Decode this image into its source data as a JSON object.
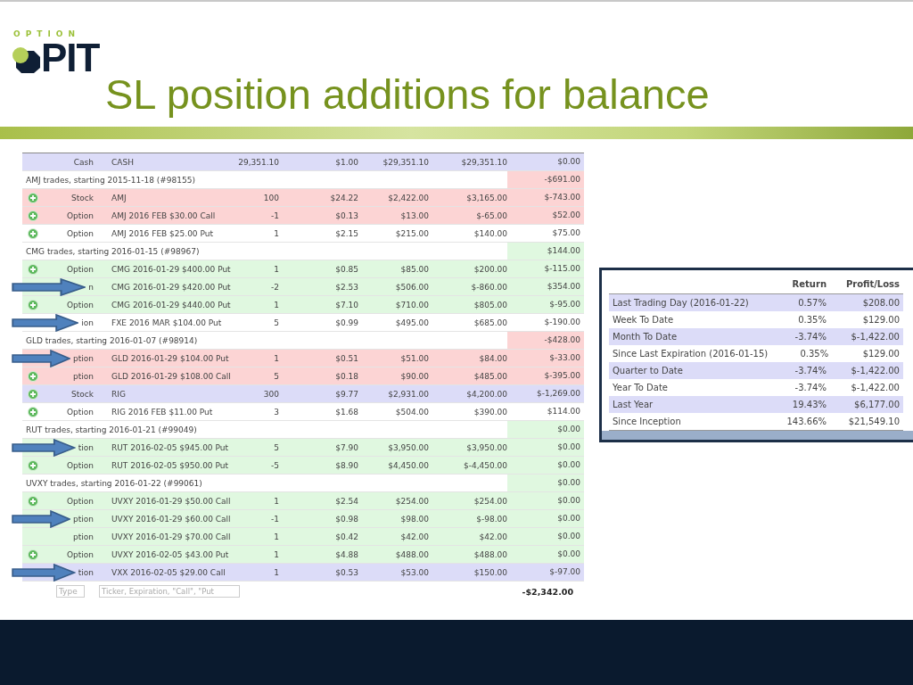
{
  "logo": {
    "top": "OPTION",
    "main": "PIT"
  },
  "title": "SL position additions for balance",
  "positions": {
    "rows": [
      {
        "kind": "position",
        "color": "#dcdcf8",
        "icon": false,
        "arrow": false,
        "type": "Cash",
        "description": "CASH",
        "quantity": "29,351.10",
        "price": "$1.00",
        "cost": "$29,351.10",
        "value": "$29,351.10",
        "pnl": "$0.00"
      },
      {
        "kind": "group",
        "label": "AMJ trades, starting 2015-11-18 (#98155)",
        "color": "#fcd4d4",
        "pnl": "-$691.00"
      },
      {
        "kind": "position",
        "color": "#fcd4d4",
        "icon": true,
        "arrow": false,
        "type": "Stock",
        "description": "AMJ",
        "quantity": "100",
        "price": "$24.22",
        "cost": "$2,422.00",
        "value": "$3,165.00",
        "pnl": "$-743.00"
      },
      {
        "kind": "position",
        "color": "#fcd4d4",
        "icon": true,
        "arrow": false,
        "type": "Option",
        "description": "AMJ 2016 FEB $30.00 Call",
        "quantity": "-1",
        "price": "$0.13",
        "cost": "$13.00",
        "value": "$-65.00",
        "pnl": "$52.00"
      },
      {
        "kind": "position",
        "color": "#ffffff",
        "icon": true,
        "arrow": false,
        "type": "Option",
        "description": "AMJ 2016 FEB $25.00 Put",
        "quantity": "1",
        "price": "$2.15",
        "cost": "$215.00",
        "value": "$140.00",
        "pnl": "$75.00"
      },
      {
        "kind": "group",
        "label": "CMG trades, starting 2016-01-15 (#98967)",
        "color": "#e0f8e0",
        "pnl": "$144.00"
      },
      {
        "kind": "position",
        "color": "#e0f8e0",
        "icon": true,
        "arrow": false,
        "type": "Option",
        "description": "CMG 2016-01-29 $400.00 Put",
        "quantity": "1",
        "price": "$0.85",
        "cost": "$85.00",
        "value": "$200.00",
        "pnl": "$-115.00"
      },
      {
        "kind": "position",
        "color": "#e0f8e0",
        "icon": false,
        "arrow": true,
        "type": "n",
        "description": "CMG 2016-01-29 $420.00 Put",
        "quantity": "-2",
        "price": "$2.53",
        "cost": "$506.00",
        "value": "$-860.00",
        "pnl": "$354.00"
      },
      {
        "kind": "position",
        "color": "#e0f8e0",
        "icon": true,
        "arrow": false,
        "type": "Option",
        "description": "CMG 2016-01-29 $440.00 Put",
        "quantity": "1",
        "price": "$7.10",
        "cost": "$710.00",
        "value": "$805.00",
        "pnl": "$-95.00"
      },
      {
        "kind": "position",
        "color": "#ffffff",
        "icon": false,
        "arrow": true,
        "type": "ion",
        "description": "FXE 2016 MAR $104.00 Put",
        "quantity": "5",
        "price": "$0.99",
        "cost": "$495.00",
        "value": "$685.00",
        "pnl": "$-190.00"
      },
      {
        "kind": "group",
        "label": "GLD trades, starting 2016-01-07 (#98914)",
        "color": "#fcd4d4",
        "pnl": "-$428.00"
      },
      {
        "kind": "position",
        "color": "#fcd4d4",
        "icon": false,
        "arrow": true,
        "type": "ption",
        "description": "GLD 2016-01-29 $104.00 Put",
        "quantity": "1",
        "price": "$0.51",
        "cost": "$51.00",
        "value": "$84.00",
        "pnl": "$-33.00"
      },
      {
        "kind": "position",
        "color": "#fcd4d4",
        "icon": true,
        "arrow": false,
        "type": "ption",
        "description": "GLD 2016-01-29 $108.00 Call",
        "quantity": "5",
        "price": "$0.18",
        "cost": "$90.00",
        "value": "$485.00",
        "pnl": "$-395.00"
      },
      {
        "kind": "position",
        "color": "#dcdcf8",
        "icon": true,
        "arrow": false,
        "type": "Stock",
        "description": "RIG",
        "quantity": "300",
        "price": "$9.77",
        "cost": "$2,931.00",
        "value": "$4,200.00",
        "pnl": "$-1,269.00"
      },
      {
        "kind": "position",
        "color": "#ffffff",
        "icon": true,
        "arrow": false,
        "type": "Option",
        "description": "RIG 2016 FEB $11.00 Put",
        "quantity": "3",
        "price": "$1.68",
        "cost": "$504.00",
        "value": "$390.00",
        "pnl": "$114.00"
      },
      {
        "kind": "group",
        "label": "RUT trades, starting 2016-01-21 (#99049)",
        "color": "#e0f8e0",
        "pnl": "$0.00"
      },
      {
        "kind": "position",
        "color": "#e0f8e0",
        "icon": false,
        "arrow": true,
        "type": "tion",
        "description": "RUT 2016-02-05 $945.00 Put",
        "quantity": "5",
        "price": "$7.90",
        "cost": "$3,950.00",
        "value": "$3,950.00",
        "pnl": "$0.00"
      },
      {
        "kind": "position",
        "color": "#e0f8e0",
        "icon": true,
        "arrow": false,
        "type": "Option",
        "description": "RUT 2016-02-05 $950.00 Put",
        "quantity": "-5",
        "price": "$8.90",
        "cost": "$4,450.00",
        "value": "$-4,450.00",
        "pnl": "$0.00"
      },
      {
        "kind": "group",
        "label": "UVXY trades, starting 2016-01-22 (#99061)",
        "color": "#e0f8e0",
        "pnl": "$0.00"
      },
      {
        "kind": "position",
        "color": "#e0f8e0",
        "icon": true,
        "arrow": false,
        "type": "Option",
        "description": "UVXY 2016-01-29 $50.00 Call",
        "quantity": "1",
        "price": "$2.54",
        "cost": "$254.00",
        "value": "$254.00",
        "pnl": "$0.00"
      },
      {
        "kind": "position",
        "color": "#e0f8e0",
        "icon": false,
        "arrow": true,
        "type": "ption",
        "description": "UVXY 2016-01-29 $60.00 Call",
        "quantity": "-1",
        "price": "$0.98",
        "cost": "$98.00",
        "value": "$-98.00",
        "pnl": "$0.00"
      },
      {
        "kind": "position",
        "color": "#e0f8e0",
        "icon": false,
        "arrow": false,
        "type": "ption",
        "description": "UVXY 2016-01-29 $70.00 Call",
        "quantity": "1",
        "price": "$0.42",
        "cost": "$42.00",
        "value": "$42.00",
        "pnl": "$0.00"
      },
      {
        "kind": "position",
        "color": "#e0f8e0",
        "icon": true,
        "arrow": false,
        "type": "Option",
        "description": "UVXY 2016-02-05 $43.00 Put",
        "quantity": "1",
        "price": "$4.88",
        "cost": "$488.00",
        "value": "$488.00",
        "pnl": "$0.00"
      },
      {
        "kind": "position",
        "color": "#dcdcf8",
        "icon": false,
        "arrow": true,
        "type": "tion",
        "description": "VXX 2016-02-05 $29.00 Call",
        "quantity": "1",
        "price": "$0.53",
        "cost": "$53.00",
        "value": "$150.00",
        "pnl": "$-97.00"
      }
    ],
    "type_field": {
      "placeholder": "Type"
    },
    "ticker_field": {
      "placeholder": "Ticker, Expiration, \"Call\", \"Put"
    },
    "total": "-$2,342.00"
  },
  "performance": {
    "columns": [
      "Return",
      "Profit/Loss"
    ],
    "rows": [
      {
        "period": "Last Trading Day (2016-01-22)",
        "return": "0.57%",
        "pnl": "$208.00"
      },
      {
        "period": "Week To Date",
        "return": "0.35%",
        "pnl": "$129.00"
      },
      {
        "period": "Month To Date",
        "return": "-3.74%",
        "pnl": "$-1,422.00"
      },
      {
        "period": "Since Last Expiration (2016-01-15)",
        "return": "0.35%",
        "pnl": "$129.00"
      },
      {
        "period": "Quarter to Date",
        "return": "-3.74%",
        "pnl": "$-1,422.00"
      },
      {
        "period": "Year To Date",
        "return": "-3.74%",
        "pnl": "$-1,422.00"
      },
      {
        "period": "Last Year",
        "return": "19.43%",
        "pnl": "$6,177.00"
      },
      {
        "period": "Since Inception",
        "return": "143.66%",
        "pnl": "$21,549.10"
      }
    ]
  }
}
